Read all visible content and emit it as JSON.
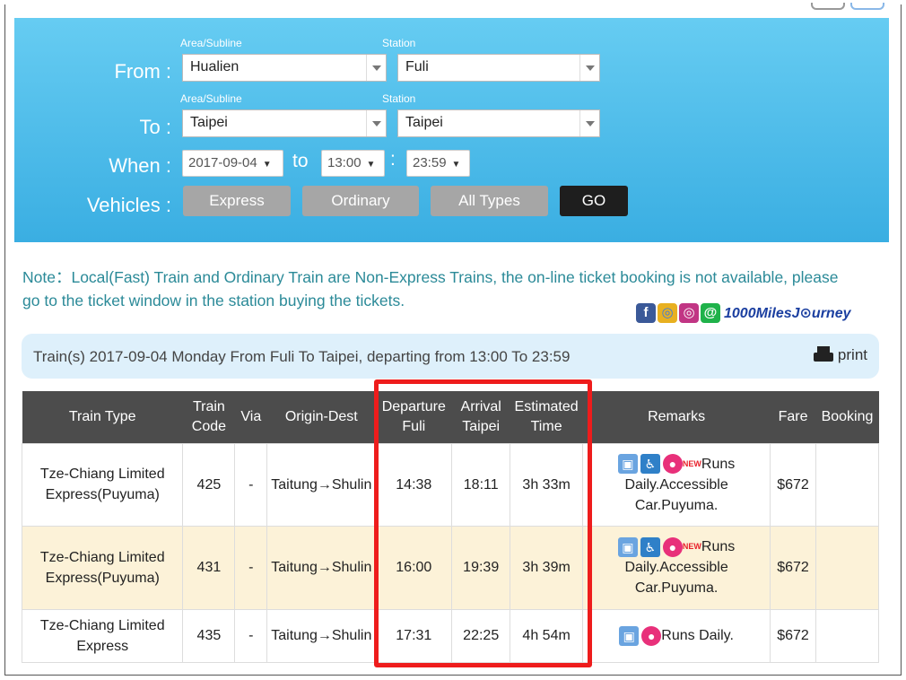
{
  "form": {
    "from_label": "From :",
    "to_label": "To :",
    "when_label": "When :",
    "vehicles_label": "Vehicles :",
    "area_sub_label": "Area/Subline",
    "station_sub_label": "Station",
    "from_area": "Hualien",
    "from_station": "Fuli",
    "to_area": "Taipei",
    "to_station": "Taipei",
    "date": "2017-09-04",
    "to_word": "to",
    "start_time": "13:00",
    "end_time": "23:59",
    "time_sep": ":",
    "dropdown_glyph": "▼"
  },
  "vehicles": {
    "express": "Express",
    "ordinary": "Ordinary",
    "all_types": "All Types",
    "go": "GO"
  },
  "note": "Note：Local(Fast) Train and Ordinary Train are Non-Express Trains, the on-line ticket booking is not available, please go to the ticket window in the station buying the tickets.",
  "social": {
    "fb": "f",
    "chrome": "◎",
    "ig": "◎",
    "line": "@",
    "brand": "1000MilesJ⊙urney"
  },
  "result": {
    "summary": "Train(s) 2017-09-04 Monday From Fuli To Taipei, departing from 13:00 To 23:59",
    "print": "print"
  },
  "table": {
    "headers": {
      "train_type": "Train Type",
      "train_code": [
        "Train",
        "Code"
      ],
      "via": "Via",
      "origin_dest": "Origin-Dest",
      "departure": [
        "Departure",
        "Fuli"
      ],
      "arrival": [
        "Arrival",
        "Taipei"
      ],
      "estimated": [
        "Estimated",
        "Time"
      ],
      "remarks": "Remarks",
      "fare": "Fare",
      "booking": "Booking"
    },
    "rows": [
      {
        "type": [
          "Tze-Chiang Limited",
          "Express(Puyuma)"
        ],
        "code": "425",
        "via": "-",
        "origin_dest": "Taitung→Shulin",
        "departure": "14:38",
        "arrival": "18:11",
        "duration": "3h 33m",
        "new_badge": "NEW",
        "remarks": [
          "Runs",
          "Daily.Accessible",
          "Car.Puyuma."
        ],
        "fare": "$672",
        "booking": ""
      },
      {
        "type": [
          "Tze-Chiang Limited",
          "Express(Puyuma)"
        ],
        "code": "431",
        "via": "-",
        "origin_dest": "Taitung→Shulin",
        "departure": "16:00",
        "arrival": "19:39",
        "duration": "3h 39m",
        "new_badge": "NEW",
        "remarks": [
          "Runs",
          "Daily.Accessible",
          "Car.Puyuma."
        ],
        "fare": "$672",
        "booking": ""
      },
      {
        "type": [
          "Tze-Chiang Limited",
          "Express"
        ],
        "code": "435",
        "via": "-",
        "origin_dest": "Taitung→Shulin",
        "departure": "17:31",
        "arrival": "22:25",
        "duration": "4h 54m",
        "remarks": [
          "Runs Daily."
        ],
        "fare": "$672",
        "booking": ""
      }
    ]
  },
  "icons": {
    "train": "train-icon",
    "wheelchair": "wheelchair-icon",
    "baby": "baby-care-icon",
    "printer": "printer-icon"
  },
  "colors": {
    "panel_top": "#66ccf2",
    "panel_bottom": "#3aaee2",
    "header_bg": "#4c4c4c",
    "alt_row": "#fcf2d8",
    "highlight": "#ee1c1c",
    "note_text": "#2b8a98"
  }
}
